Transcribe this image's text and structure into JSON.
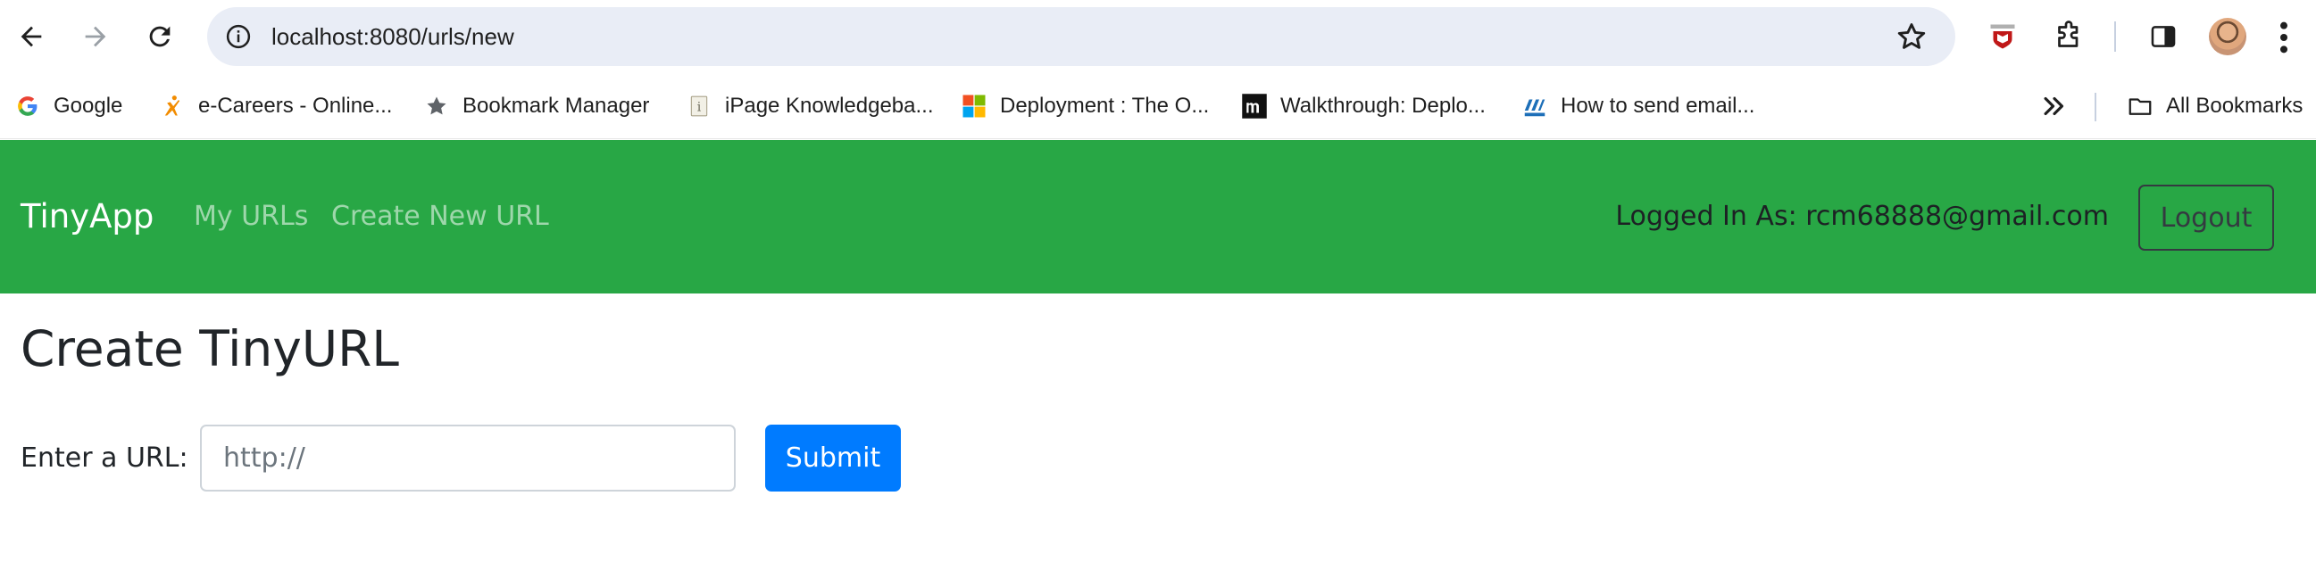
{
  "browser": {
    "url": "localhost:8080/urls/new",
    "bookmarks": [
      {
        "label": "Google",
        "icon": "google-icon"
      },
      {
        "label": "e-Careers - Online...",
        "icon": "ecareers-icon"
      },
      {
        "label": "Bookmark Manager",
        "icon": "star-icon"
      },
      {
        "label": "iPage Knowledgeba...",
        "icon": "ipage-icon"
      },
      {
        "label": "Deployment : The O...",
        "icon": "microsoft-icon"
      },
      {
        "label": "Walkthrough: Deplo...",
        "icon": "m-icon"
      },
      {
        "label": "How to send email...",
        "icon": "aspnet-icon"
      }
    ],
    "all_bookmarks_label": "All Bookmarks"
  },
  "navbar": {
    "brand": "TinyApp",
    "links": [
      "My URLs",
      "Create New URL"
    ],
    "logged_in_text": "Logged In As: rcm68888@gmail.com",
    "logout_label": "Logout",
    "bg_color": "#28a745"
  },
  "page": {
    "title": "Create TinyURL",
    "url_label": "Enter a URL:",
    "url_placeholder": "http://",
    "submit_label": "Submit",
    "submit_color": "#007bff"
  }
}
